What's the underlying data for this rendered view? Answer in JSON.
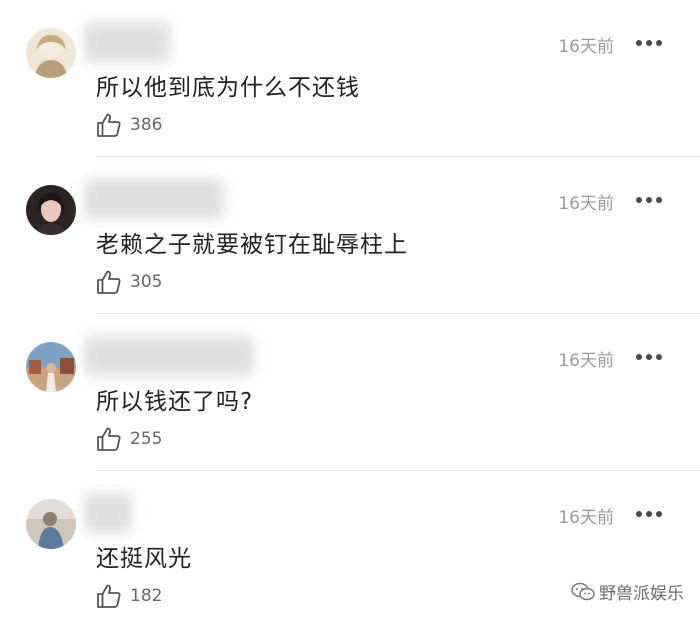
{
  "comments": [
    {
      "text": "所以他到底为什么不还钱",
      "time": "16天前",
      "likes": "386",
      "avatar": {
        "bg": "#efe6d6",
        "accent": "#b79e7d",
        "hair": "#caa97f",
        "name_blur_width": 86
      }
    },
    {
      "text": "老赖之子就要被钉在耻辱柱上",
      "time": "16天前",
      "likes": "305",
      "avatar": {
        "bg": "#2b2324",
        "accent": "#e9c9bd",
        "hair": "#1d1718",
        "name_blur_width": 140
      }
    },
    {
      "text": "所以钱还了吗?",
      "time": "16天前",
      "likes": "255",
      "avatar": {
        "bg": "#7fa2c4",
        "accent": "#d8b7a0",
        "hair": "#a15f3f",
        "name_blur_width": 170
      }
    },
    {
      "text": "还挺风光",
      "time": "16天前",
      "likes": "182",
      "avatar": {
        "bg": "#cfc6bb",
        "accent": "#5d7a9c",
        "hair": "#8c8172",
        "name_blur_width": 48
      }
    }
  ],
  "watermark": {
    "text": "野兽派娱乐"
  },
  "colors": {
    "time": "#9a9a9a",
    "text": "#222222",
    "like": "#666666",
    "divider": "#e9e9e9"
  },
  "icons": {
    "like": "thumbs-up-icon",
    "more": "more-dots-icon",
    "watermark": "wechat-icon"
  }
}
